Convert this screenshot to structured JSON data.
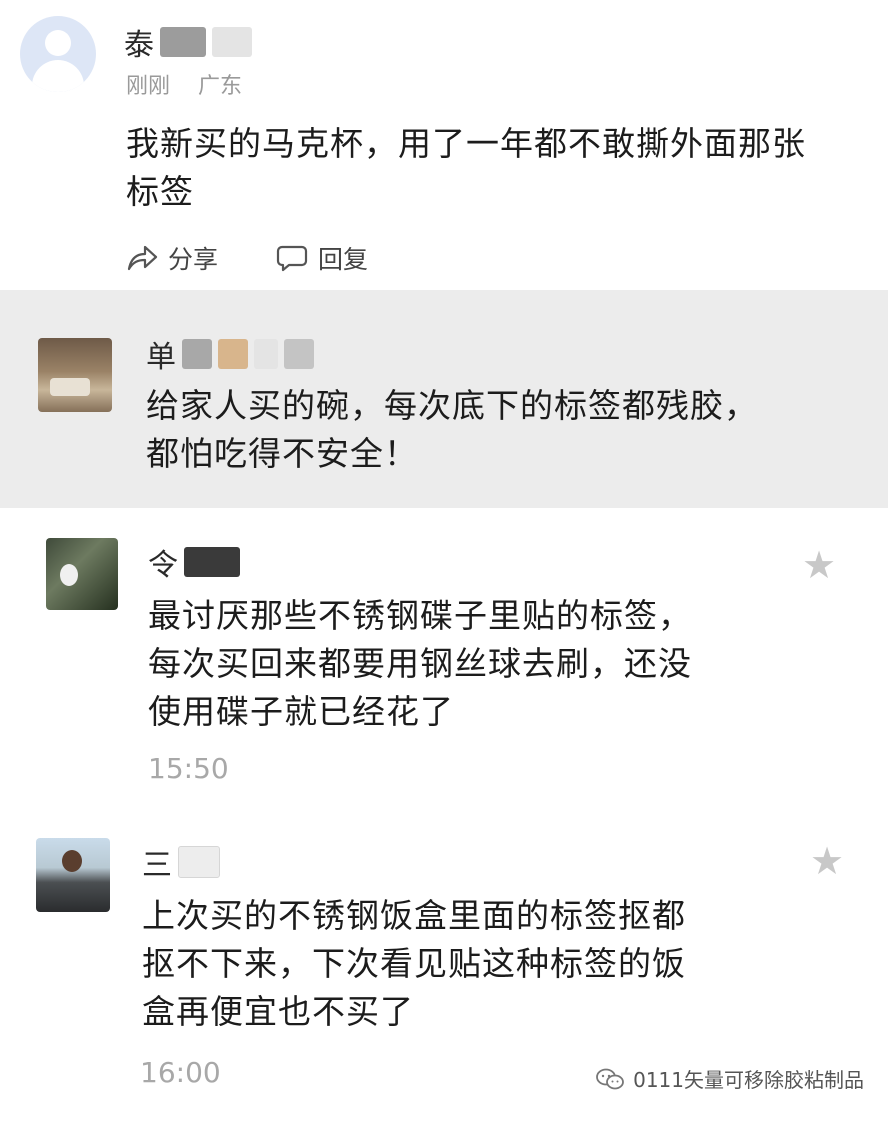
{
  "comments": [
    {
      "username": "泰",
      "time_ago": "刚刚",
      "location": "广东",
      "text_lines": [
        "我新买的马克杯，用了一年都不敢撕外面那张",
        "标签"
      ],
      "share_label": "分享",
      "reply_label": "回复"
    },
    {
      "username": "单",
      "text_lines": [
        "给家人买的碗，每次底下的标签都残胶，",
        "都怕吃得不安全！"
      ]
    },
    {
      "username": "令",
      "text_lines": [
        "最讨厌那些不锈钢碟子里贴的标签，",
        "每次买回来都要用钢丝球去刷，还没",
        "使用碟子就已经花了"
      ],
      "time": "15:50"
    },
    {
      "username": "三",
      "text_lines": [
        "上次买的不锈钢饭盒里面的标签抠都",
        "抠不下来，下次看见贴这种标签的饭",
        "盒再便宜也不买了"
      ],
      "time": "16:00"
    }
  ],
  "watermark": "0111矢量可移除胶粘制品",
  "icons": {
    "share": "share-arrow-icon",
    "reply": "speech-bubble-icon",
    "star": "star-icon",
    "watermark": "wechat-icon"
  }
}
